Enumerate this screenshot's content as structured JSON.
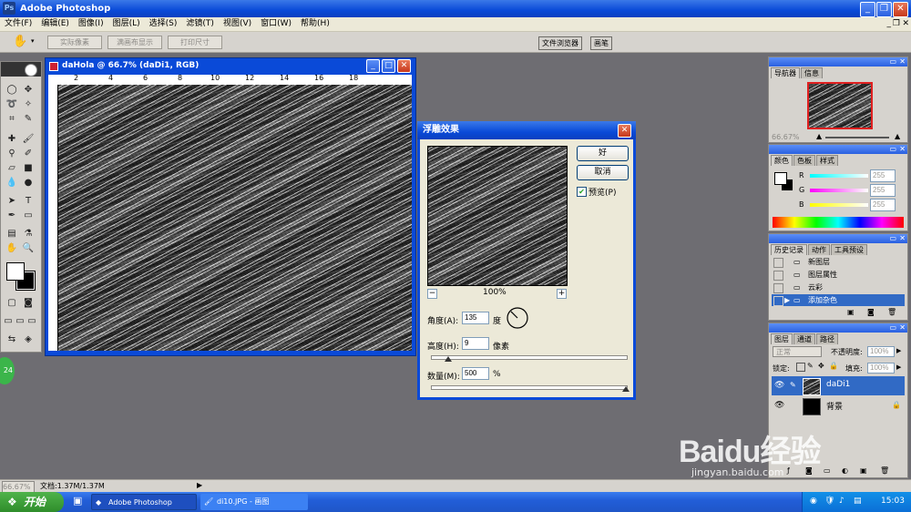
{
  "app": {
    "title": "Adobe Photoshop",
    "title_icon": "photoshop-logo-icon"
  },
  "menu": [
    "文件(F)",
    "编辑(E)",
    "图像(I)",
    "图层(L)",
    "选择(S)",
    "滤镜(T)",
    "视图(V)",
    "窗口(W)",
    "帮助(H)"
  ],
  "options_bar": {
    "buttons": [
      "实际像素",
      "满画布显示",
      "打印尺寸"
    ],
    "wells": [
      "文件浏览器",
      "画笔"
    ]
  },
  "document": {
    "title": "daHola @ 66.7% (daDi1, RGB)",
    "ruler_ticks": [
      "2",
      "4",
      "6",
      "8",
      "10",
      "12",
      "14",
      "16",
      "18"
    ]
  },
  "dialog": {
    "title": "浮雕效果",
    "ok": "好",
    "cancel": "取消",
    "preview_label": "预览(P)",
    "preview_checked": true,
    "zoom": "100%",
    "angle_label": "角度(A):",
    "angle_value": "135",
    "angle_unit": "度",
    "height_label": "高度(H):",
    "height_value": "9",
    "height_unit": "像素",
    "amount_label": "数量(M):",
    "amount_value": "500",
    "amount_unit": "%",
    "height_fraction": 0.09,
    "amount_fraction": 1.0
  },
  "navigator": {
    "tabs": [
      "导航器",
      "信息"
    ],
    "zoom": "66.67%"
  },
  "color": {
    "tabs": [
      "颜色",
      "色板",
      "样式"
    ],
    "channels": [
      {
        "label": "R",
        "value": "255",
        "color": "#ff4040"
      },
      {
        "label": "G",
        "value": "255",
        "color": "#40c040"
      },
      {
        "label": "B",
        "value": "255",
        "color": "#4040ff"
      }
    ]
  },
  "history": {
    "tabs": [
      "历史记录",
      "动作",
      "工具预设"
    ],
    "items": [
      "新图层",
      "图层属性",
      "云彩",
      "添加杂色"
    ]
  },
  "layers": {
    "tabs": [
      "图层",
      "通道",
      "路径"
    ],
    "blend_mode": "正常",
    "opacity_label": "不透明度:",
    "opacity": "100%",
    "lock_label": "锁定:",
    "fill_label": "填充:",
    "fill": "100%",
    "items": [
      "daDi1",
      "背景"
    ]
  },
  "status": {
    "zoom": "66.67%",
    "doc": "文档:1.37M/1.37M"
  },
  "taskbar": {
    "start": "开始",
    "tasks": [
      "Adobe Photoshop",
      "di10.JPG - 画图"
    ],
    "clock": "15:03"
  },
  "watermark": {
    "brand": "Baidu经验",
    "url": "jingyan.baidu.com"
  },
  "side_badge": "24",
  "accent": "#0a4ad8"
}
